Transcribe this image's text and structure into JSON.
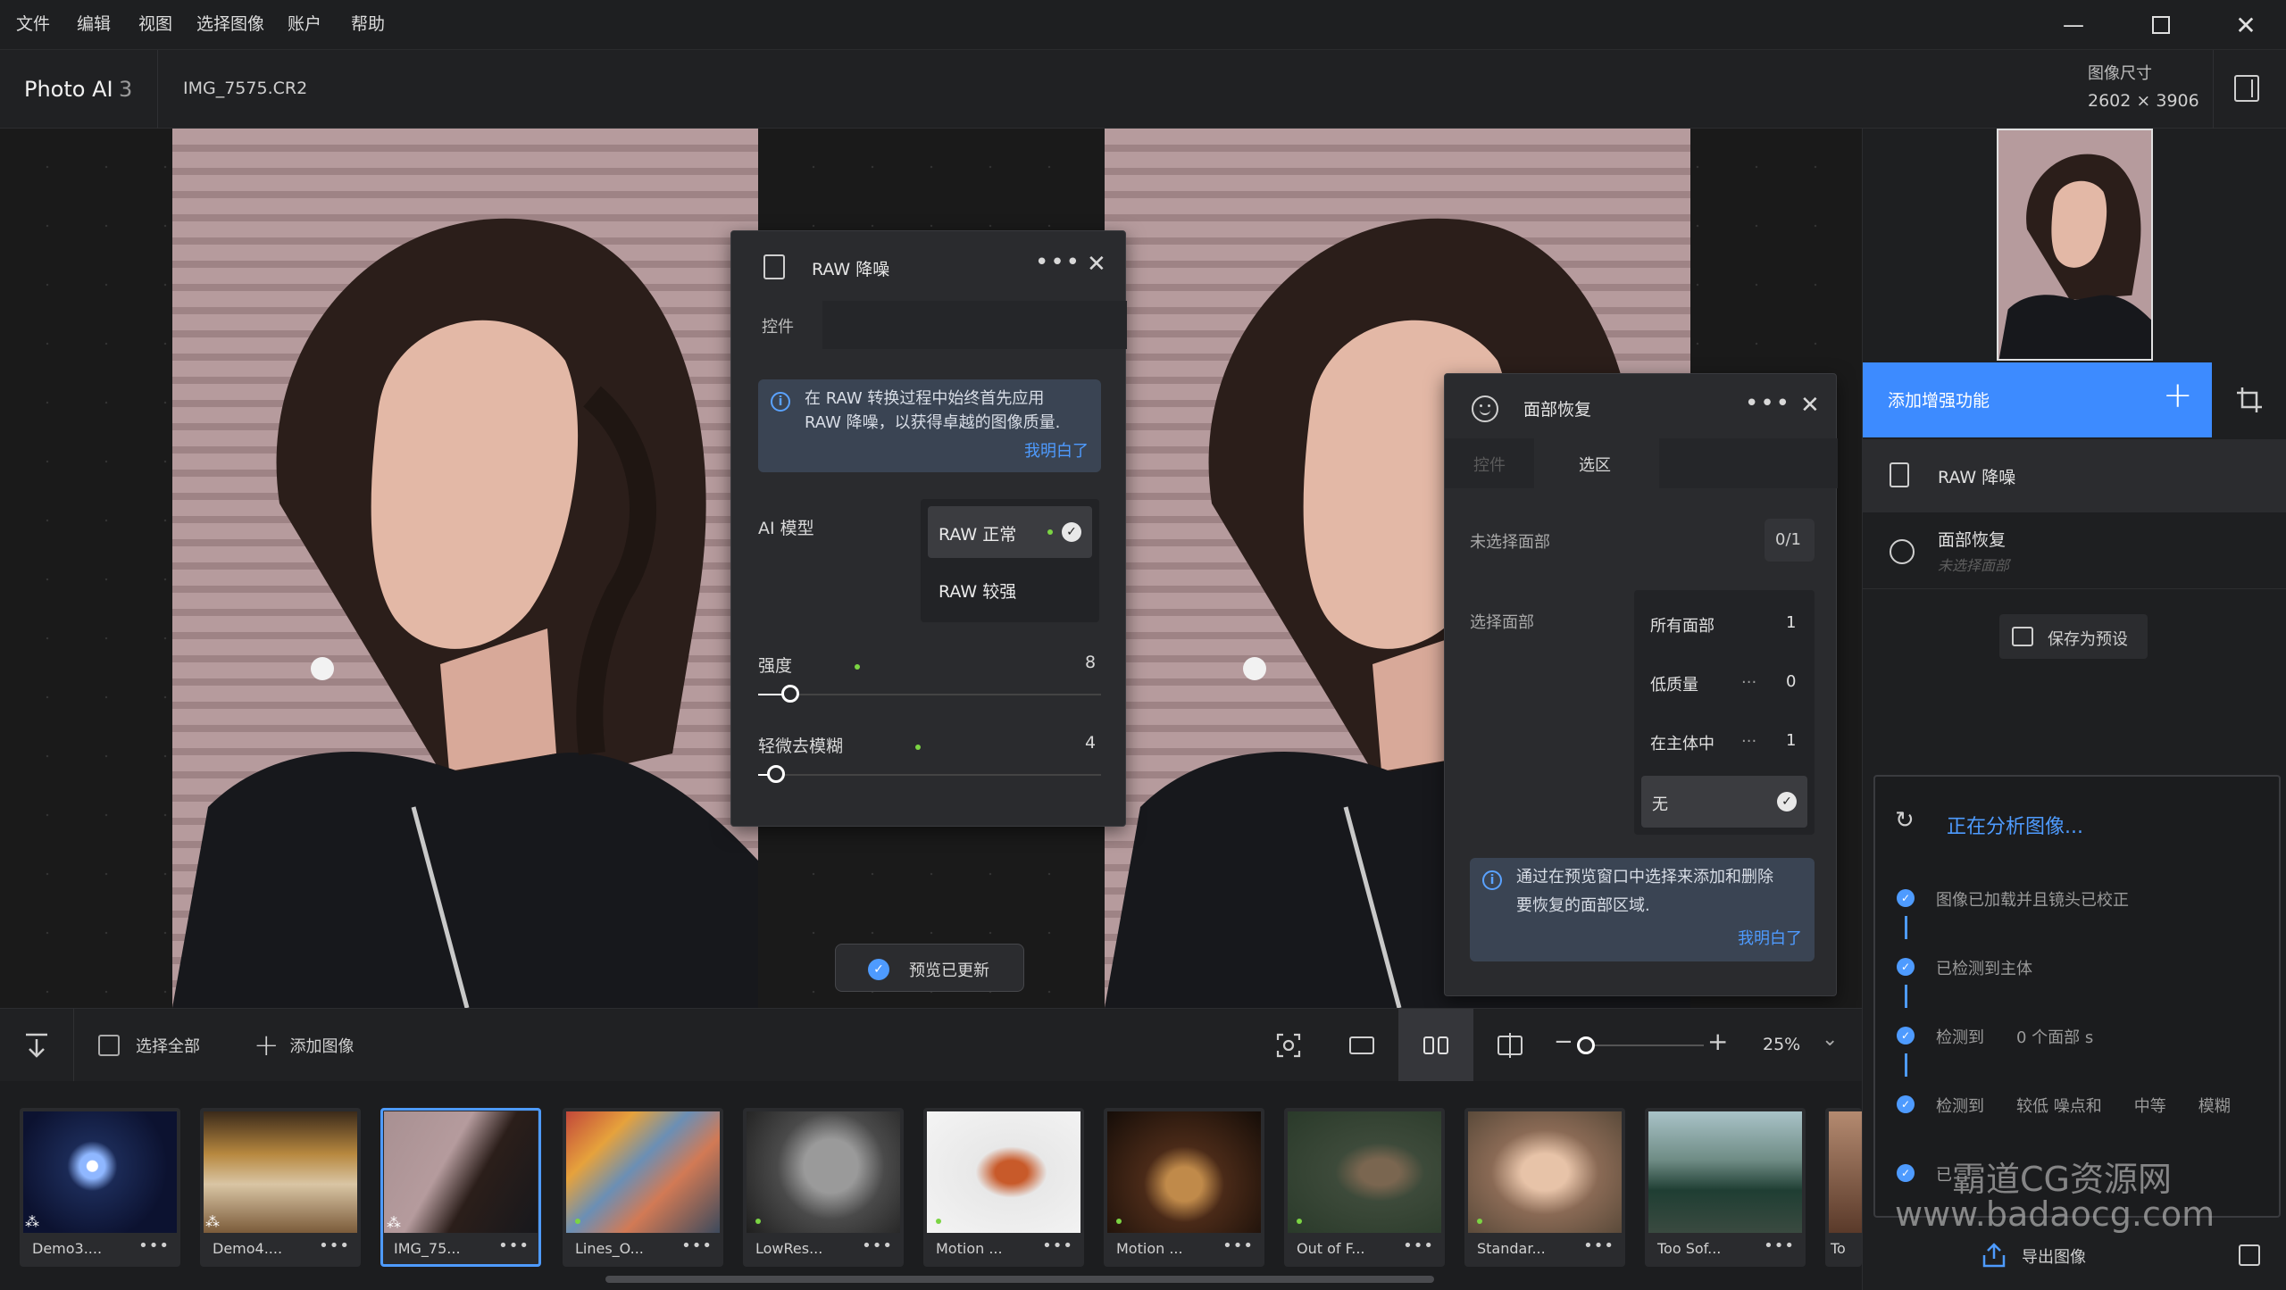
{
  "menu": [
    "文件",
    "编辑",
    "视图",
    "选择图像",
    "账户",
    "帮助"
  ],
  "app": {
    "name": "Photo AI",
    "version": "3",
    "filename": "IMG_7575.CR2"
  },
  "image_size": {
    "label": "图像尺寸",
    "value": "2602 × 3906"
  },
  "raw_panel": {
    "title": "RAW 降噪",
    "tab": "控件",
    "info_text_1": "在 RAW 转换过程中始终首先应用",
    "info_text_2": "RAW 降噪，以获得卓越的图像质量.",
    "info_link": "我明白了",
    "ai_model_label": "AI 模型",
    "model_options": [
      "RAW 正常",
      "RAW 较强"
    ],
    "strength_label": "强度",
    "strength_value": "8",
    "deblur_label": "轻微去模糊",
    "deblur_value": "4"
  },
  "face_panel": {
    "title": "面部恢复",
    "tabs": [
      "控件",
      "选区"
    ],
    "unselected_label": "未选择面部",
    "unselected_count": "0/1",
    "select_label": "选择面部",
    "options": [
      {
        "label": "所有面部",
        "dots": "",
        "count": "1"
      },
      {
        "label": "低质量",
        "dots": "...",
        "count": "0"
      },
      {
        "label": "在主体中",
        "dots": "...",
        "count": "1"
      },
      {
        "label": "无",
        "dots": "",
        "count": ""
      }
    ],
    "info_text_1": "通过在预览窗口中选择来添加和删除",
    "info_text_2": "要恢复的面部区域.",
    "info_link": "我明白了"
  },
  "preview_updated": "预览已更新",
  "sidebar": {
    "add_enhance": "添加增强功能",
    "items": [
      {
        "label": "RAW 降噪",
        "sub": ""
      },
      {
        "label": "面部恢复",
        "sub": "未选择面部"
      }
    ],
    "save_preset": "保存为预设",
    "export": "导出图像"
  },
  "analysis": {
    "title": "正在分析图像...",
    "steps": [
      "图像已加载并且镜头已校正",
      "已检测到主体",
      "检测到　　0 个面部 s",
      "检测到　　较低  噪点和　　中等　　模糊",
      "已"
    ]
  },
  "toolbar": {
    "select_all": "选择全部",
    "add_image": "添加图像",
    "zoom": "25%"
  },
  "thumbnails": [
    {
      "label": "Demo3...."
    },
    {
      "label": "Demo4...."
    },
    {
      "label": "IMG_75..."
    },
    {
      "label": "Lines_O..."
    },
    {
      "label": "LowRes..."
    },
    {
      "label": "Motion ..."
    },
    {
      "label": "Motion ..."
    },
    {
      "label": "Out of F..."
    },
    {
      "label": "Standar..."
    },
    {
      "label": "Too Sof..."
    },
    {
      "label": "To"
    }
  ],
  "watermark_1": "霸道CG资源网",
  "watermark_2": "www.badaocg.com"
}
